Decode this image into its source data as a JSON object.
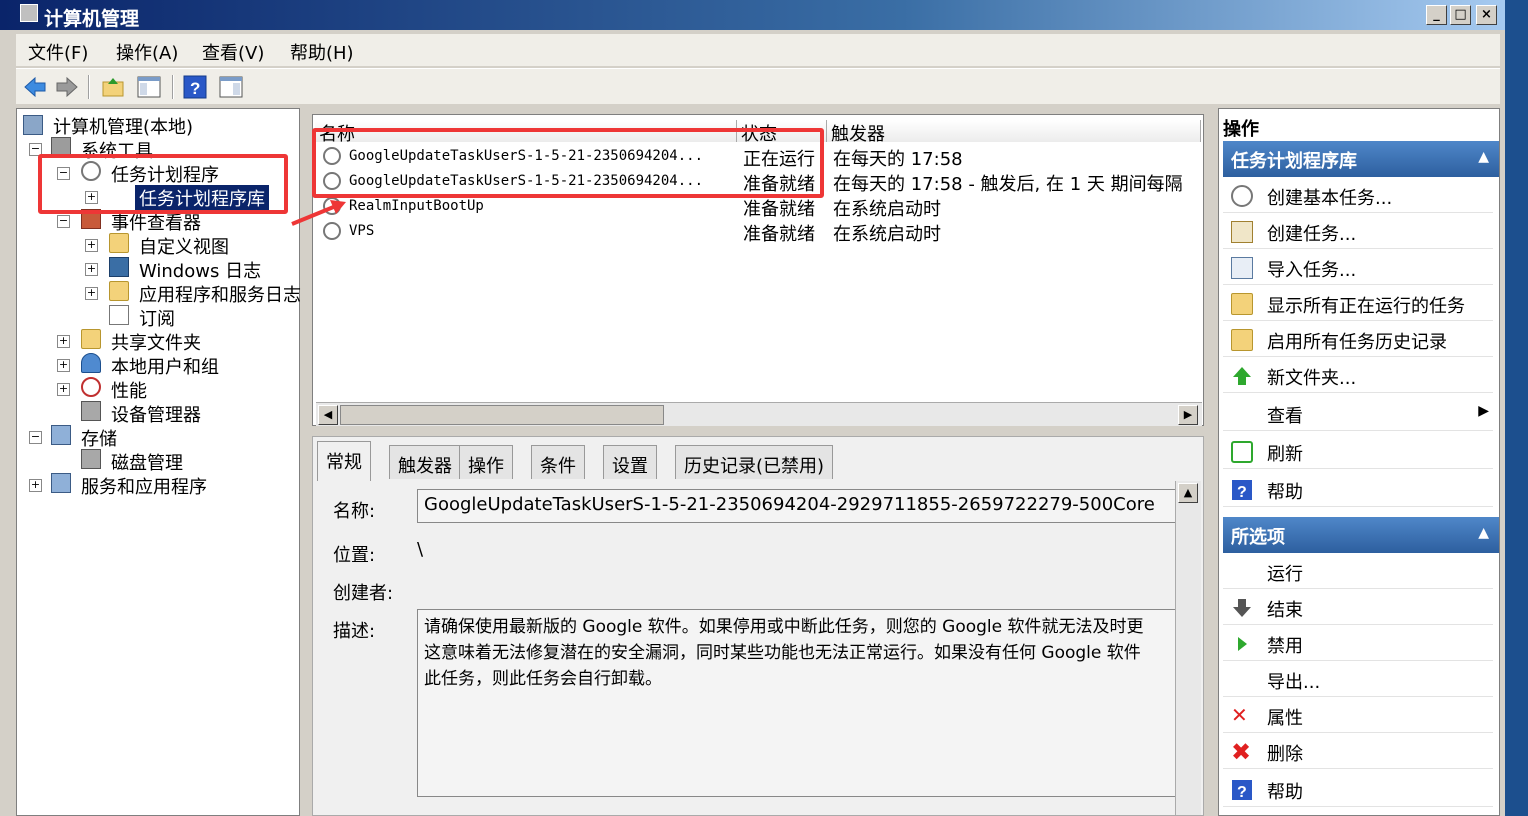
{
  "window": {
    "title": "计算机管理"
  },
  "menu": [
    "文件(F)",
    "操作(A)",
    "查看(V)",
    "帮助(H)"
  ],
  "tree": {
    "root": "计算机管理(本地)",
    "system_tools": "系统工具",
    "task_scheduler": "任务计划程序",
    "task_library": "任务计划程序库",
    "event_viewer": "事件查看器",
    "custom_views": "自定义视图",
    "windows_logs": "Windows 日志",
    "app_logs": "应用程序和服务日志",
    "subscriptions": "订阅",
    "shared_folders": "共享文件夹",
    "local_users": "本地用户和组",
    "performance": "性能",
    "device_manager": "设备管理器",
    "storage": "存储",
    "disk_mgmt": "磁盘管理",
    "services_apps": "服务和应用程序"
  },
  "task_list": {
    "headers": [
      "名称",
      "状态",
      "触发器"
    ],
    "rows": [
      {
        "name": "GoogleUpdateTaskUserS-1-5-21-2350694204...",
        "status": "正在运行",
        "trigger": "在每天的 17:58"
      },
      {
        "name": "GoogleUpdateTaskUserS-1-5-21-2350694204...",
        "status": "准备就绪",
        "trigger": "在每天的 17:58 - 触发后, 在 1 天 期间每隔"
      },
      {
        "name": "RealmInputBootUp",
        "status": "准备就绪",
        "trigger": "在系统启动时"
      },
      {
        "name": "VPS",
        "status": "准备就绪",
        "trigger": "在系统启动时"
      }
    ]
  },
  "detail": {
    "tabs": [
      "常规",
      "触发器",
      "操作",
      "条件",
      "设置",
      "历史记录(已禁用)"
    ],
    "name_label": "名称:",
    "name_value": "GoogleUpdateTaskUserS-1-5-21-2350694204-2929711855-2659722279-500Core",
    "location_label": "位置:",
    "location_value": "\\",
    "author_label": "创建者:",
    "desc_label": "描述:",
    "desc_line1": "请确保使用最新版的 Google 软件。如果停用或中断此任务，则您的 Google 软件就无法及时更",
    "desc_line2": "这意味着无法修复潜在的安全漏洞，同时某些功能也无法正常运行。如果没有任何 Google 软件",
    "desc_line3": "此任务，则此任务会自行卸载。"
  },
  "actions": {
    "header": "操作",
    "section1": "任务计划程序库",
    "items1": [
      "创建基本任务...",
      "创建任务...",
      "导入任务...",
      "显示所有正在运行的任务",
      "启用所有任务历史记录",
      "新文件夹...",
      "查看",
      "刷新",
      "帮助"
    ],
    "section2": "所选项",
    "items2": [
      "运行",
      "结束",
      "禁用",
      "导出...",
      "属性",
      "删除",
      "帮助"
    ]
  },
  "colors": {
    "highlight": "#ee3636",
    "selection": "#0a246a",
    "section": "#2d5f9f"
  }
}
